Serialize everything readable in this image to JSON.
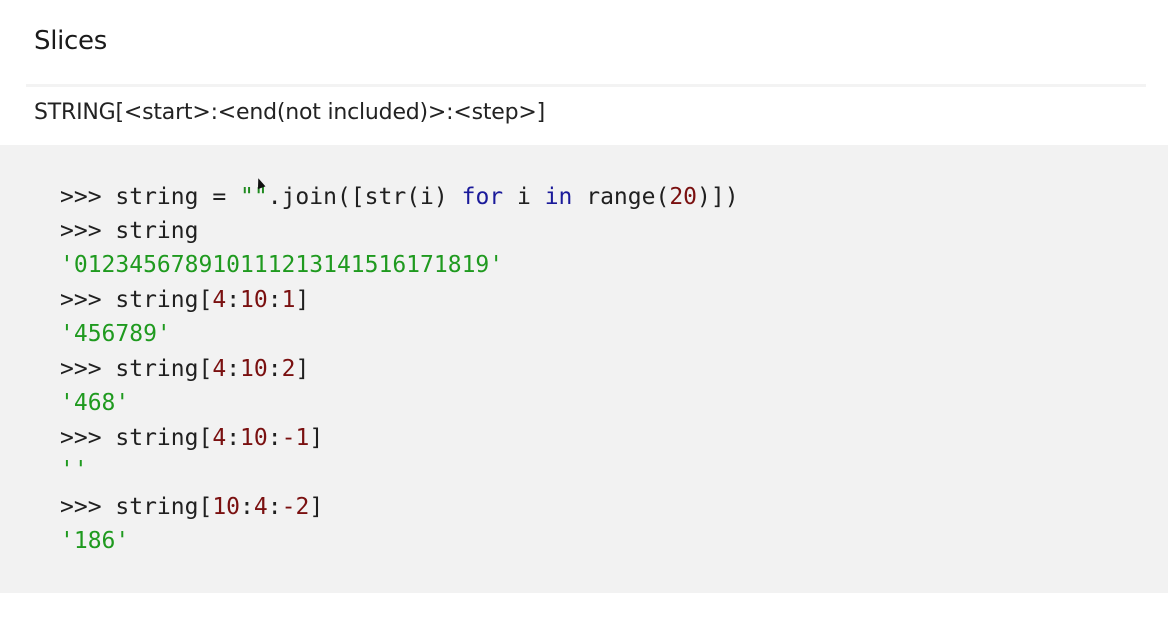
{
  "heading": {
    "title": "Slices"
  },
  "syntax": {
    "text": "STRING[<start>:<end(not included)>:<step>]"
  },
  "code": {
    "line1": {
      "prompt": ">>> ",
      "pre": "string = ",
      "str": "\"\"",
      "mid": ".join([str(i) ",
      "kw_for": "for",
      "mid2": " i ",
      "kw_in": "in",
      "mid3": " range(",
      "num": "20",
      "end": ")])"
    },
    "line2": {
      "prompt": ">>> ",
      "text": "string"
    },
    "line3": {
      "output": "'012345678910111213141516171819'"
    },
    "line4": {
      "prompt": ">>> ",
      "pre": "string[",
      "a": "4",
      "sep1": ":",
      "b": "10",
      "sep2": ":",
      "c": "1",
      "end": "]"
    },
    "line5": {
      "output": "'456789'"
    },
    "line6": {
      "prompt": ">>> ",
      "pre": "string[",
      "a": "4",
      "sep1": ":",
      "b": "10",
      "sep2": ":",
      "c": "2",
      "end": "]"
    },
    "line7": {
      "output": "'468'"
    },
    "line8": {
      "prompt": ">>> ",
      "pre": "string[",
      "a": "4",
      "sep1": ":",
      "b": "10",
      "sep2": ":",
      "c": "-1",
      "end": "]"
    },
    "line9": {
      "output": "''"
    },
    "line10": {
      "prompt": ">>> ",
      "pre": "string[",
      "a": "10",
      "sep1": ":",
      "b": "4",
      "sep2": ":",
      "c": "-2",
      "end": "]"
    },
    "line11": {
      "output": "'186'"
    }
  }
}
